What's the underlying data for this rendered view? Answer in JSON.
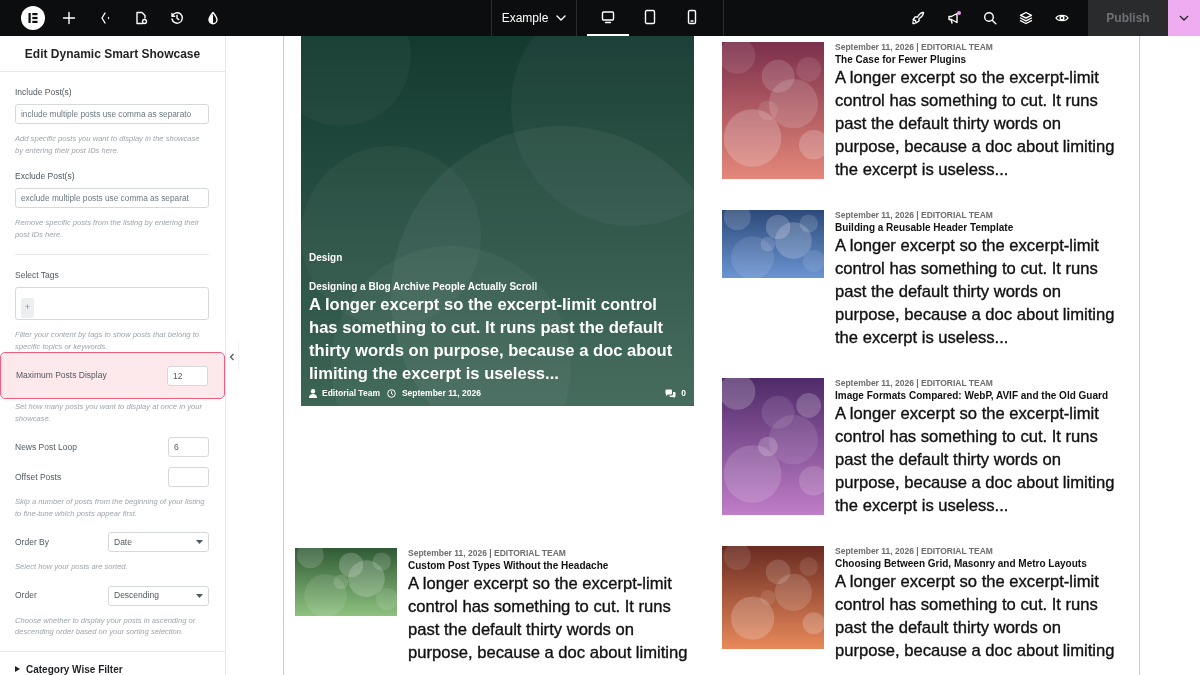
{
  "topbar": {
    "page_selector": "Example",
    "devices": [
      {
        "kind": "desktop",
        "selected": true
      },
      {
        "kind": "tablet",
        "selected": false
      },
      {
        "kind": "mobile",
        "selected": false
      }
    ],
    "publish": {
      "label": "Publish",
      "disabled": true
    }
  },
  "panel": {
    "title": "Edit Dynamic Smart Showcase",
    "controls": [
      {
        "kind": "text",
        "label": "Include Post(s)",
        "placeholder": "include multiple posts use comma as separato",
        "help": "Add specific posts you want to display in the showcase by entering their post IDs here.",
        "highlighted": false
      },
      {
        "kind": "text",
        "label": "Exclude Post(s)",
        "placeholder": "exclude multiple posts use comma as separat",
        "help": "Remove specific posts from the listing by entering their post IDs here.",
        "highlighted": false
      },
      {
        "kind": "divider"
      },
      {
        "kind": "tags",
        "label": "Select Tags",
        "add_label": "+",
        "help": "Filter your content by tags to show posts that belong to specific topics or keywords.",
        "highlighted": false
      },
      {
        "kind": "number",
        "label": "Maximum Posts Display",
        "value": "12",
        "help": "Set how many posts you want to display at once in your showcase.",
        "highlighted": true
      },
      {
        "kind": "number",
        "label": "News Post Loop",
        "value": "6",
        "highlighted": false
      },
      {
        "kind": "number",
        "label": "Offset Posts",
        "help": "Skip a number of posts from the beginning of your listing to fine-tune which posts appear first.",
        "highlighted": false
      },
      {
        "kind": "select",
        "label": "Order By",
        "value": "Date",
        "help": "Select how your posts are sorted.",
        "highlighted": false
      },
      {
        "kind": "select",
        "label": "Order",
        "value": "Descending",
        "help": "Choose whether to display your posts in ascending or descending order based on your sorting selection.",
        "highlighted": false
      }
    ],
    "section": {
      "label": "Category Wise Filter",
      "expanded": false
    }
  },
  "featured": {
    "category": "Design",
    "title": "Designing a Blog Archive People Actually Scroll",
    "excerpt": "A longer excerpt so the excerpt-limit control has something to cut. It runs past the default thirty words on purpose, because a doc about limiting the excerpt is useless...",
    "author": "Editorial Team",
    "date": "September 11, 2026",
    "comments": "0"
  },
  "left_posts": [
    {
      "kind": "wide",
      "meta": "September 11, 2026 | EDITORIAL TEAM",
      "title": "Custom Post Types Without the Headache",
      "excerpt": "A longer excerpt so the excerpt-limit control has something to cut. It runs past the default thirty words on purpose, because a doc about limiting"
    }
  ],
  "right_posts": [
    {
      "kind": "tall",
      "meta": "September 11, 2026 | EDITORIAL TEAM",
      "title": "The Case for Fewer Plugins",
      "excerpt": "A longer excerpt so the excerpt-limit control has something to cut. It runs past the default thirty words on purpose, because a doc about limiting the excerpt is useless..."
    },
    {
      "kind": "wide",
      "meta": "September 11, 2026 | EDITORIAL TEAM",
      "title": "Building a Reusable Header Template",
      "excerpt": "A longer excerpt so the excerpt-limit control has something to cut. It runs past the default thirty words on purpose, because a doc about limiting the excerpt is useless..."
    },
    {
      "kind": "tall",
      "meta": "September 11, 2026 | EDITORIAL TEAM",
      "title": "Image Formats Compared: WebP, AVIF and the Old Guard",
      "excerpt": "A longer excerpt so the excerpt-limit control has something to cut. It runs past the default thirty words on purpose, because a doc about limiting the excerpt is useless..."
    },
    {
      "kind": "square",
      "meta": "September 11, 2026 | EDITORIAL TEAM",
      "title": "Choosing Between Grid, Masonry and Metro Layouts",
      "excerpt": "A longer excerpt so the excerpt-limit control has something to cut. It runs past the default thirty words on purpose, because a doc about limiting"
    }
  ]
}
